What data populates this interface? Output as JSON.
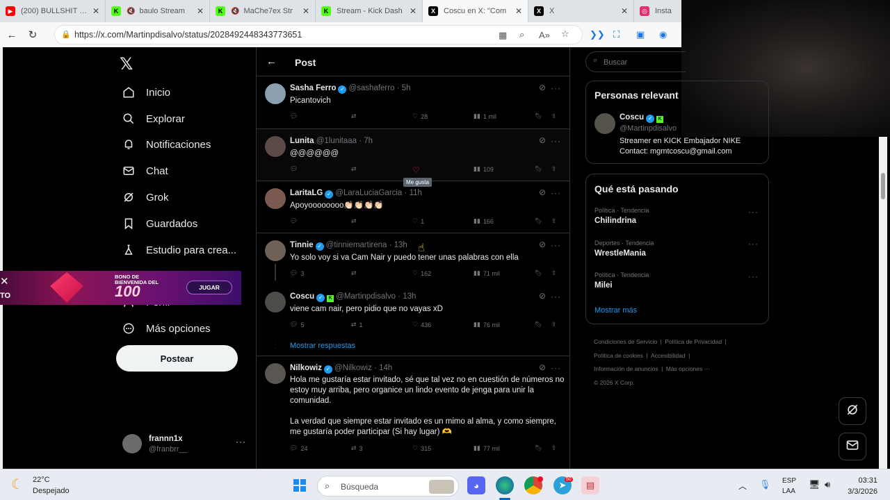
{
  "browser": {
    "tabs": [
      {
        "title": "(200) BULLSHIT 2 -",
        "icon": "youtube-icon",
        "color": "#ff0000"
      },
      {
        "title": "baulo Stream",
        "icon": "kick-icon",
        "color": "#53fc18"
      },
      {
        "title": "MaChe7ex Str",
        "icon": "kick-icon",
        "color": "#53fc18"
      },
      {
        "title": "Stream - Kick Dash",
        "icon": "kick-icon",
        "color": "#53fc18"
      },
      {
        "title": "Coscu en X: \"Com",
        "icon": "x-icon",
        "color": "#000000"
      },
      {
        "title": "X",
        "icon": "x-icon",
        "color": "#000000"
      },
      {
        "title": "Insta",
        "icon": "instagram-icon",
        "color": "#e1306c"
      }
    ],
    "url": "https://x.com/Martinpdisalvo/status/2028492448343773651"
  },
  "nav": {
    "items": [
      "Inicio",
      "Explorar",
      "Notificaciones",
      "Chat",
      "Grok",
      "Guardados",
      "Estudio para crea...",
      "Perfil",
      "Más opciones"
    ],
    "post_button": "Postear",
    "user_name": "frannn1x",
    "user_handle": "@franbrr__"
  },
  "ad": {
    "left_text": "TO",
    "line1": "BONO DE",
    "line2": "BIENVENIDA DEL",
    "big": "100",
    "cta": "JUGAR"
  },
  "header": {
    "title": "Post"
  },
  "tweets": [
    {
      "name": "Sasha Ferro",
      "handle": "@sashaferro · 5h",
      "text": "Picantovich",
      "reply": "",
      "rt": "",
      "like": "28",
      "views": "1 mil"
    },
    {
      "name": "Lunita",
      "handle": "@1lunitaaa · 7h",
      "text": "@@@@@@",
      "reply": "",
      "rt": "",
      "like": "",
      "views": "109",
      "tooltip": "Me gusta"
    },
    {
      "name": "LaritaLG",
      "handle": "@LaraLuciaGarcia · 11h",
      "text": "Apoyoooooooo👏🏻👏🏻👏🏻👏🏻",
      "reply": "",
      "rt": "",
      "like": "1",
      "views": "166"
    },
    {
      "name": "Tinnie",
      "handle": "@tinniemartirena · 13h",
      "text": "Yo solo voy si va Cam Nair y puedo tener unas palabras con ella",
      "reply": "3",
      "rt": "",
      "like": "162",
      "views": "71 mil"
    },
    {
      "name": "Coscu",
      "handle": "@Martinpdisalvo · 13h",
      "text": "viene cam nair, pero pidio que no vayas xD",
      "reply": "5",
      "rt": "1",
      "like": "436",
      "views": "76 mil",
      "show_replies": "Mostrar respuestas"
    },
    {
      "name": "Nilkowiz",
      "handle": "@Nilkowiz · 14h",
      "text": "Hola me gustaría estar invitado, sé que tal vez no en cuestión de números no estoy muy arriba, pero organice un lindo evento de jenga para unir la comunidad.",
      "text2": "La verdad que siempre estar invitado es un mimo al alma, y como siempre, me gustaría poder participar (Si hay lugar) 🫶",
      "reply": "24",
      "rt": "3",
      "like": "315",
      "views": "77 mil"
    }
  ],
  "right": {
    "search_placeholder": "Buscar",
    "relevant_title": "Personas relevant",
    "person_name": "Coscu",
    "person_handle": "@Martinpdisalvo",
    "person_bio1": "Streamer en KICK Embajador NIKE",
    "person_bio2": "Contact: mgmtcoscu@gmail.com",
    "trends_title": "Qué está pasando",
    "trends": [
      {
        "cat": "Política · Tendencia",
        "name": "Chilindrina"
      },
      {
        "cat": "Deportes · Tendencia",
        "name": "WrestleMania"
      },
      {
        "cat": "Política · Tendencia",
        "name": "Milei"
      }
    ],
    "show_more": "Mostrar más",
    "footer": [
      "Condiciones de Servicio",
      "Política de Privacidad",
      "Política de cookies",
      "Accesibilidad",
      "Información de anuncios",
      "Más opciones ···",
      "© 2026 X Corp."
    ]
  },
  "taskbar": {
    "temp": "22°C",
    "weather": "Despejado",
    "search": "Búsqueda",
    "lang1": "ESP",
    "lang2": "LAA",
    "time": "03:31",
    "date": "3/3/2026",
    "badge": "50"
  },
  "colors": {
    "accent": "#1d9bf0",
    "like": "#f91880",
    "kick": "#53fc18"
  }
}
